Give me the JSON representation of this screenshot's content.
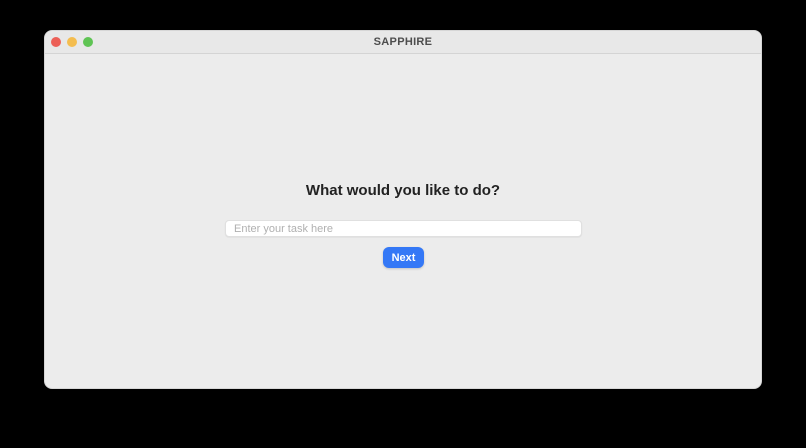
{
  "window": {
    "title": "SAPPHIRE"
  },
  "traffic_lights": {
    "close_color": "#ec5f57",
    "minimize_color": "#f4bd4f",
    "zoom_color": "#5fc454"
  },
  "main": {
    "prompt": "What would you like to do?",
    "task_input": {
      "value": "",
      "placeholder": "Enter your task here"
    },
    "next_button": {
      "label": "Next",
      "color": "#3478f6"
    }
  }
}
